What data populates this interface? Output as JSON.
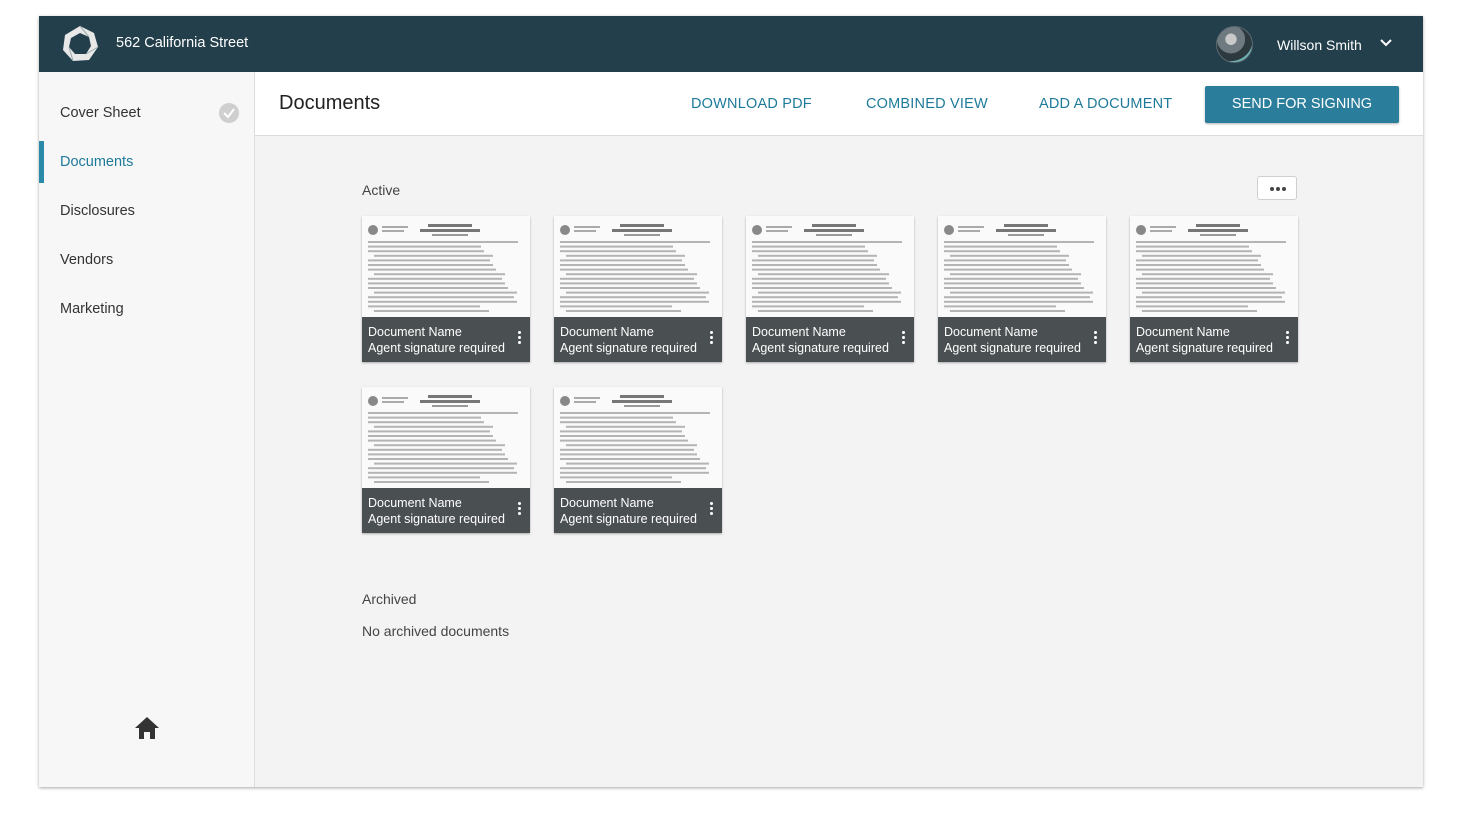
{
  "app": {
    "title": "562 California Street",
    "user_name": "Willson Smith",
    "accent": "#2a7d9b",
    "topbar_color": "#233f4b"
  },
  "sidebar": {
    "items": [
      {
        "label": "Cover Sheet",
        "completed": true
      },
      {
        "label": "Documents",
        "active": true
      },
      {
        "label": "Disclosures"
      },
      {
        "label": "Vendors"
      },
      {
        "label": "Marketing"
      }
    ],
    "home_icon": "home-icon"
  },
  "header": {
    "title": "Documents",
    "links": [
      "DOWNLOAD PDF",
      "COMBINED VIEW",
      "ADD A DOCUMENT"
    ],
    "primary_button": "SEND FOR SIGNING"
  },
  "active_section": {
    "label": "Active",
    "more_icon": "more-horizontal-icon",
    "documents": [
      {
        "name": "Document Name",
        "status": "Agent signature required"
      },
      {
        "name": "Document Name",
        "status": "Agent signature required"
      },
      {
        "name": "Document Name",
        "status": "Agent signature required"
      },
      {
        "name": "Document Name",
        "status": "Agent signature required"
      },
      {
        "name": "Document Name",
        "status": "Agent signature required"
      },
      {
        "name": "Document Name",
        "status": "Agent signature required"
      },
      {
        "name": "Document Name",
        "status": "Agent signature required"
      }
    ]
  },
  "archived_section": {
    "label": "Archived",
    "empty_text": "No archived documents"
  }
}
